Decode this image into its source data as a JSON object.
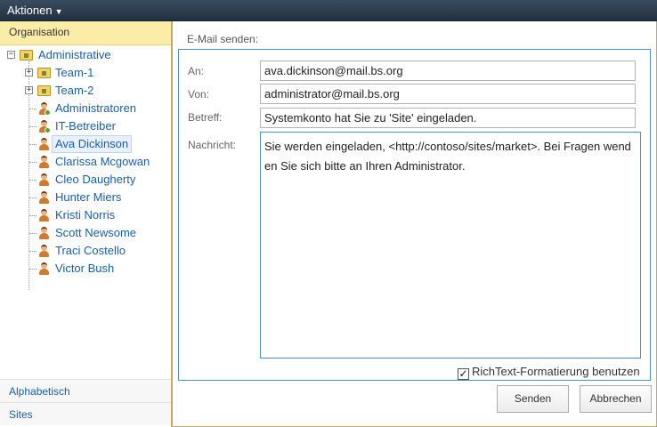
{
  "menu": {
    "actions_label": "Aktionen"
  },
  "sidebar": {
    "header": "Organisation",
    "tree": {
      "root": "Administrative",
      "children": [
        {
          "label": "Team-1",
          "type": "folder"
        },
        {
          "label": "Team-2",
          "type": "folder"
        },
        {
          "label": "Administratoren",
          "type": "group"
        },
        {
          "label": "IT-Betreiber",
          "type": "group"
        },
        {
          "label": "Ava Dickinson",
          "type": "user",
          "selected": true
        },
        {
          "label": "Clarissa Mcgowan",
          "type": "user"
        },
        {
          "label": "Cleo Daugherty",
          "type": "user"
        },
        {
          "label": "Hunter Miers",
          "type": "user"
        },
        {
          "label": "Kristi Norris",
          "type": "user"
        },
        {
          "label": "Scott Newsome",
          "type": "user"
        },
        {
          "label": "Traci Costello",
          "type": "user"
        },
        {
          "label": "Victor Bush",
          "type": "user"
        }
      ]
    },
    "nav": [
      "Alphabetisch",
      "Sites"
    ]
  },
  "email": {
    "title": "E-Mail senden:",
    "to_label": "An:",
    "to_value": "ava.dickinson@mail.bs.org",
    "from_label": "Von:",
    "from_value": "administrator@mail.bs.org",
    "subject_label": "Betreff:",
    "subject_value": "Systemkonto hat Sie zu 'Site' eingeladen.",
    "message_label": "Nachricht:",
    "message_value": "Sie werden eingeladen, <http://contoso/sites/market>. Bei Fragen wenden Sie sich bitte an Ihren Administrator.",
    "richtext_label": "RichText-Formatierung benutzen",
    "richtext_checked": true
  },
  "buttons": {
    "send": "Senden",
    "cancel": "Abbrechen"
  },
  "colors": {
    "accent": "#4a91cf",
    "header_bg": "#22313f",
    "sidebar_header_bg": "#fbeca8",
    "link": "#1a5ea8"
  }
}
